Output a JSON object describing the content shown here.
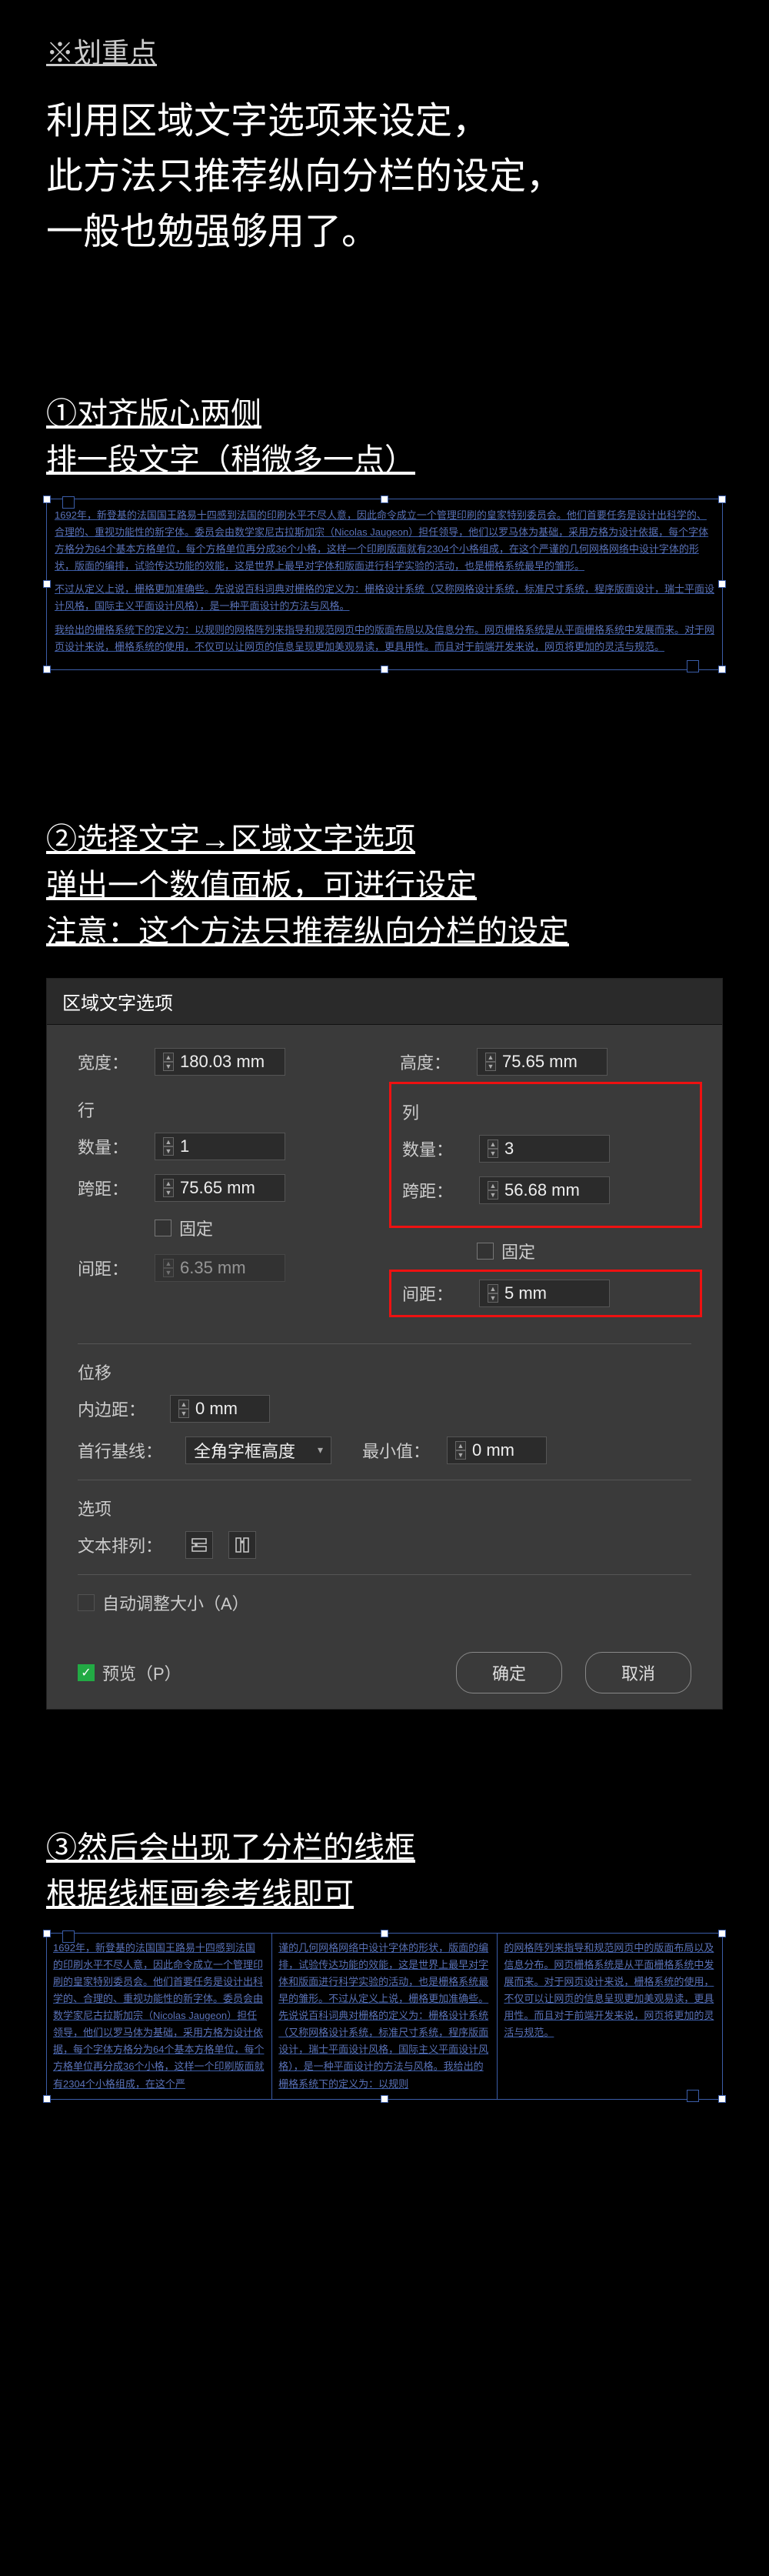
{
  "key": {
    "header": "※划重点",
    "body": "利用区域文字选项来设定，\n此方法只推荐纵向分栏的设定，\n一般也勉强够用了。"
  },
  "step1": {
    "title": "①对齐版心两侧\n排一段文字（稍微多一点）",
    "para1": "1692年，新登基的法国国王路易十四感到法国的印刷水平不尽人意，因此命令成立一个管理印刷的皇家特别委员会。他们首要任务是设计出科学的、合理的、重视功能性的新字体。委员会由数学家尼古拉斯加宗（Nicolas Jaugeon）担任领导，他们以罗马体为基础，采用方格为设计依据，每个字体方格分为64个基本方格单位，每个方格单位再分成36个小格，这样一个印刷版面就有2304个小格组成，在这个严谨的几何网格网络中设计字体的形状，版面的编排，试验传达功能的效能，这是世界上最早对字体和版面进行科学实验的活动，也是栅格系统最早的雏形。",
    "para2": "不过从定义上说，栅格更加准确些。先说说百科词典对栅格的定义为：栅格设计系统（又称网格设计系统，标准尺寸系统，程序版面设计，瑞士平面设计风格，国际主义平面设计风格），是一种平面设计的方法与风格。",
    "para3": "我给出的栅格系统下的定义为：以规则的网格阵列来指导和规范网页中的版面布局以及信息分布。网页栅格系统是从平面栅格系统中发展而来。对于网页设计来说，栅格系统的使用，不仅可以让网页的信息呈现更加美观易读，更具用性。而且对于前端开发来说，网页将更加的灵活与规范。"
  },
  "step2": {
    "title": "②选择文字→区域文字选项\n弹出一个数值面板，可进行设定\n注意：这个方法只推荐纵向分栏的设定"
  },
  "dialog": {
    "title": "区域文字选项",
    "width_label": "宽度：",
    "width_value": "180.03 mm",
    "height_label": "高度：",
    "height_value": "75.65 mm",
    "rows_section": "行",
    "cols_section": "列",
    "count_label": "数量：",
    "rows_count": "1",
    "cols_count": "3",
    "span_label": "跨距：",
    "rows_span": "75.65 mm",
    "cols_span": "56.68 mm",
    "fixed_label": "固定",
    "gutter_label": "间距：",
    "rows_gutter": "6.35 mm",
    "cols_gutter": "5 mm",
    "offset_section": "位移",
    "inset_label": "内边距：",
    "inset_value": "0 mm",
    "baseline_label": "首行基线：",
    "baseline_value": "全角字框高度",
    "min_label": "最小值：",
    "min_value": "0 mm",
    "options_section": "选项",
    "flow_label": "文本排列：",
    "auto_resize": "自动调整大小（A）",
    "preview": "预览（P）",
    "ok": "确定",
    "cancel": "取消"
  },
  "step3": {
    "title": "③然后会出现了分栏的线框\n根据线框画参考线即可",
    "col1": "1692年，新登基的法国国王路易十四感到法国的印刷水平不尽人意，因此命令成立一个管理印刷的皇家特别委员会。他们首要任务是设计出科学的、合理的、重视功能性的新字体。委员会由数学家尼古拉斯加宗（Nicolas Jaugeon）担任领导，他们以罗马体为基础，采用方格为设计依据，每个字体方格分为64个基本方格单位，每个方格单位再分成36个小格，这样一个印刷版面就有2304个小格组成，在这个严",
    "col2": "谨的几何网格网络中设计字体的形状，版面的编排，试验传达功能的效能，这是世界上最早对字体和版面进行科学实验的活动，也是栅格系统最早的雏形。不过从定义上说，栅格更加准确些。先说说百科词典对栅格的定义为：栅格设计系统（又称网格设计系统，标准尺寸系统，程序版面设计，瑞士平面设计风格，国际主义平面设计风格），是一种平面设计的方法与风格。我给出的栅格系统下的定义为：以规则",
    "col3": "的网格阵列来指导和规范网页中的版面布局以及信息分布。网页栅格系统是从平面栅格系统中发展而来。对于网页设计来说，栅格系统的使用，不仅可以让网页的信息呈现更加美观易读，更具用性。而且对于前端开发来说，网页将更加的灵活与规范。"
  }
}
